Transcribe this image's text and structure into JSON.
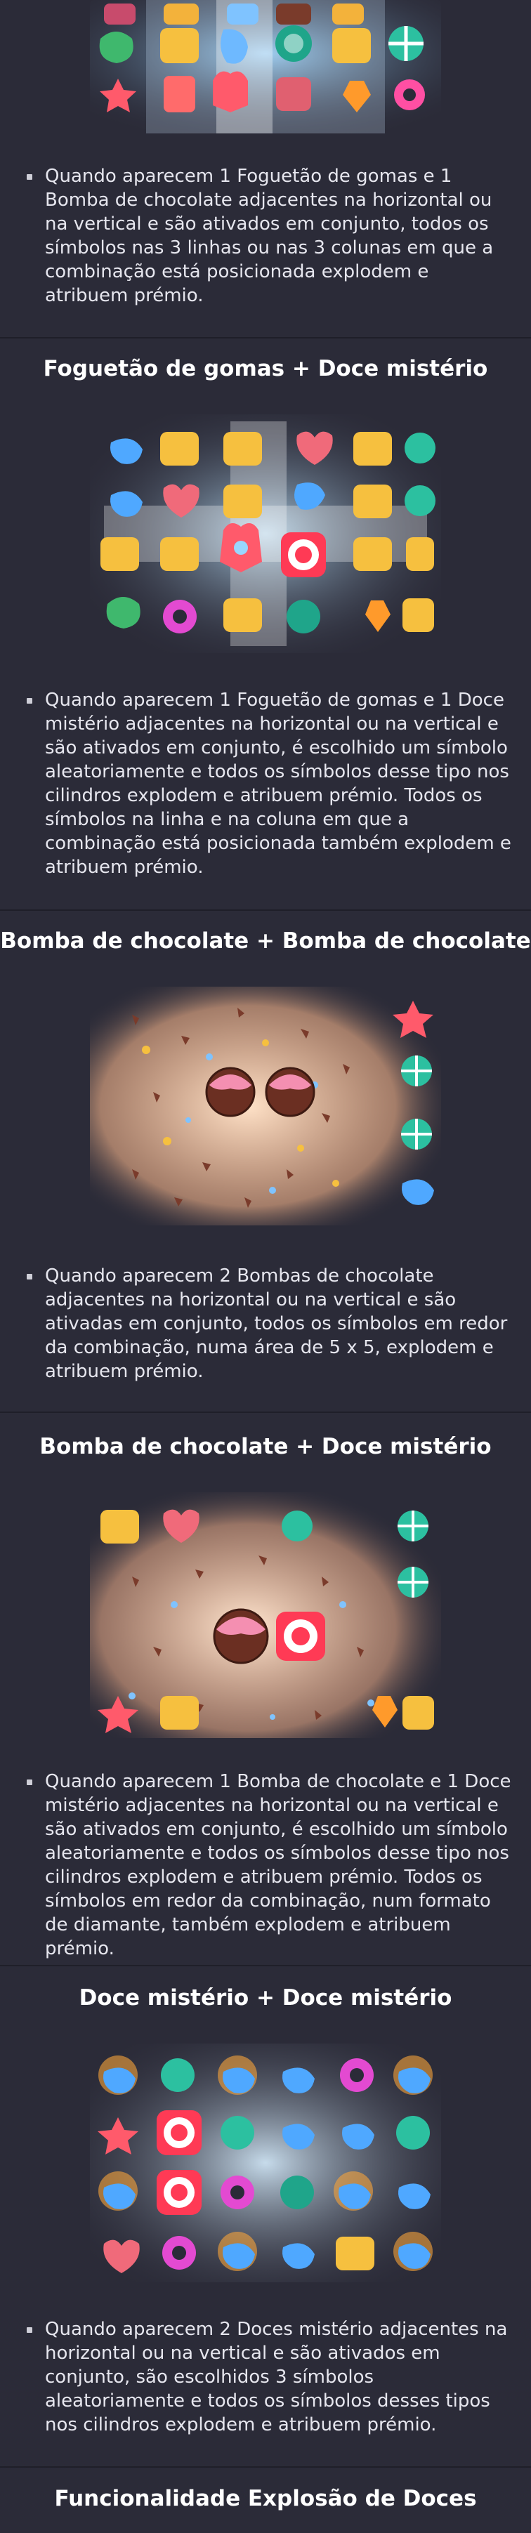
{
  "sections": [
    {
      "id": "rocket-bomb",
      "heading": "",
      "text": "Quando aparecem 1 Foguetão de gomas e 1 Bomba de chocolate adjacentes na horizontal ou na vertical e são ativados em conjunto, todos os símbolos nas 3 linhas ou nas 3 colunas em que a combinação está posicionada explodem e atribuem prémio."
    },
    {
      "id": "rocket-mystery",
      "heading": "Foguetão de gomas + Doce mistério",
      "text": "Quando aparecem 1 Foguetão de gomas e 1 Doce mistério adjacentes na horizontal ou na vertical e são ativados em conjunto, é escolhido um símbolo aleatoriamente e todos os símbolos desse tipo nos cilindros explodem e atribuem prémio. Todos os símbolos na linha e na coluna em que a combinação está posicionada também explodem e atribuem prémio."
    },
    {
      "id": "bomb-bomb",
      "heading": "Bomba de chocolate + Bomba de chocolate",
      "text": "Quando aparecem 2 Bombas de chocolate adjacentes na horizontal ou na vertical e são ativadas em conjunto, todos os símbolos em redor da combinação, numa área de 5 x 5, explodem e atribuem prémio."
    },
    {
      "id": "bomb-mystery",
      "heading": "Bomba de chocolate + Doce mistério",
      "text": "Quando aparecem 1 Bomba de chocolate e 1 Doce mistério adjacentes na horizontal ou na vertical e são ativados em conjunto, é escolhido um símbolo aleatoriamente e todos os símbolos desse tipo nos cilindros explodem e atribuem prémio. Todos os símbolos em redor da combinação, num formato de diamante, também explodem e atribuem prémio."
    },
    {
      "id": "mystery-mystery",
      "heading": "Doce mistério + Doce mistério",
      "text": "Quando aparecem 2 Doces mistério adjacentes na horizontal ou na vertical e são ativados em conjunto, são escolhidos 3 símbolos aleatoriamente e todos os símbolos desses tipos nos cilindros explodem e atribuem prémio."
    },
    {
      "id": "explosion-feature",
      "heading": "Funcionalidade Explosão de Doces",
      "text": ""
    }
  ],
  "colors": {
    "background": "#2b2b38",
    "divider": "#1f1f29",
    "heading": "#ffffff",
    "text": "#e6e6ee"
  }
}
